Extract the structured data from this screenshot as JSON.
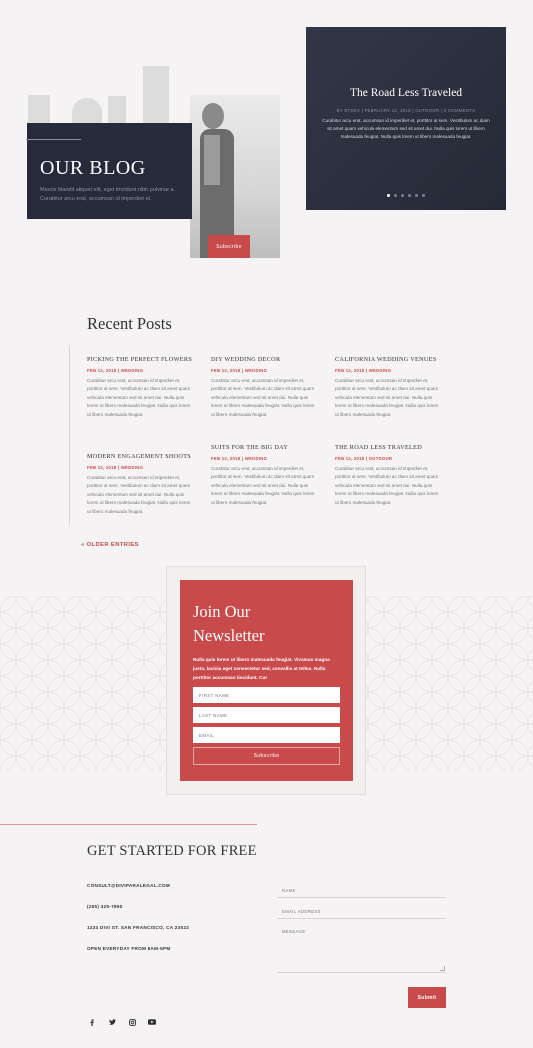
{
  "hero": {
    "blog_title": "OUR BLOG",
    "blog_desc": "Mauris blandit aliquet elit, eget tincidunt nibh pulvinar a. Curabitur arcu erat, accumsan id imperdiet et.",
    "subscribe_label": "Subscribe"
  },
  "slider": {
    "title": "The Road Less Traveled",
    "meta": "BY ETDEV | FEBRUARY 12, 2018 | OUTDOOR | 0 COMMENTS",
    "text": "Curabitur arcu erat, accumsan id imperdiet et, porttitor at sem. Vestibulum ac diam sit amet quam vehicula elementum sed sit amet dui. Nulla quis lorem ut libero malesuada feugiat. Nulla quis lorem ut libero malesuada feugiat.",
    "dot_count": 6,
    "active_dot": 0
  },
  "recent_posts": {
    "title": "Recent Posts",
    "posts": [
      {
        "title": "PICKING THE PERFECT FLOWERS",
        "meta": "FEB 12, 2018 | WEDDING",
        "excerpt": "Curabitur arcu erat, accumsan id imperdiet et, porttitor at sem. Vestibulum ac diam sit amet quam vehicula elementum sed sit amet dui. Nulla quis lorem ut libero malesuada feugiat. Nulla quis lorem ut libero malesuada feugiat."
      },
      {
        "title": "DIY WEDDING DECOR",
        "meta": "FEB 12, 2018 | WEDDING",
        "excerpt": "Curabitur arcu erat, accumsan id imperdiet et, porttitor at sem. Vestibulum ac diam sit amet quam vehicula elementum sed sit amet dui. Nulla quis lorem ut libero malesuada feugiat. Nulla quis lorem ut libero malesuada feugiat."
      },
      {
        "title": "CALIFORNIA WEDDING VENUES",
        "meta": "FEB 12, 2018 | WEDDING",
        "excerpt": "Curabitur arcu erat, accumsan id imperdiet et, porttitor at sem. Vestibulum ac diam sit amet quam vehicula elementum sed sit amet dui. Nulla quis lorem ut libero malesuada feugiat. Nulla quis lorem ut libero malesuada feugiat."
      },
      {
        "title": "MODERN ENGAGEMENT SHOOTS",
        "meta": "FEB 12, 2018 | WEDDING",
        "excerpt": "Curabitur arcu erat, accumsan id imperdiet et, porttitor at sem. Vestibulum ac diam sit amet quam vehicula elementum sed sit amet dui. Nulla quis lorem ut libero malesuada feugiat. Nulla quis lorem ut libero malesuada feugiat."
      },
      {
        "title": "SUITS FOR THE BIG DAY",
        "meta": "FEB 12, 2018 | WEDDING",
        "excerpt": "Curabitur arcu erat, accumsan id imperdiet et, porttitor at sem. Vestibulum ac diam sit amet quam vehicula elementum sed sit amet dui. Nulla quis lorem ut libero malesuada feugiat. Nulla quis lorem ut libero malesuada feugiat."
      },
      {
        "title": "THE ROAD LESS TRAVELED",
        "meta": "FEB 12, 2018 | OUTDOOR",
        "excerpt": "Curabitur arcu erat, accumsan id imperdiet et, porttitor at sem. Vestibulum ac diam sit amet quam vehicula elementum sed sit amet dui. Nulla quis lorem ut libero malesuada feugiat. Nulla quis lorem ut libero malesuada feugiat."
      }
    ],
    "older_label": "« OLDER ENTRIES"
  },
  "newsletter": {
    "title_line1": "Join Our",
    "title_line2": "Newsletter",
    "text": "Nulla quis lorem ut libero malesuada feugiat. Vivamus magna justo, lacinia eget consectetur sed, convallis at tellus. Nulla porttitor accumsan tincidunt. Cur",
    "first_name_placeholder": "FIRST NAME",
    "last_name_placeholder": "LAST NAME",
    "email_placeholder": "EMAIL",
    "subscribe_label": "Subscribe"
  },
  "get_started": {
    "title": "GET STARTED FOR  FREE",
    "email": "CONSULT@DIVIPARALEGAL.COM",
    "phone": "(255) 325-7890",
    "address": "1234 DIVI ST. SAN FRANCISCO, CA 23522",
    "hours": "OPEN EVERYDAY FROM 8AM-5PM",
    "name_placeholder": "NAME",
    "email_placeholder": "EMAIL ADDRESS",
    "message_placeholder": "MESSAGE",
    "submit_label": "Submit"
  },
  "social": {
    "icons": [
      "facebook-icon",
      "twitter-icon",
      "instagram-icon",
      "youtube-icon"
    ]
  },
  "colors": {
    "accent": "#c94a4a",
    "navy": "#262a3b",
    "background": "#f5f3f3"
  }
}
